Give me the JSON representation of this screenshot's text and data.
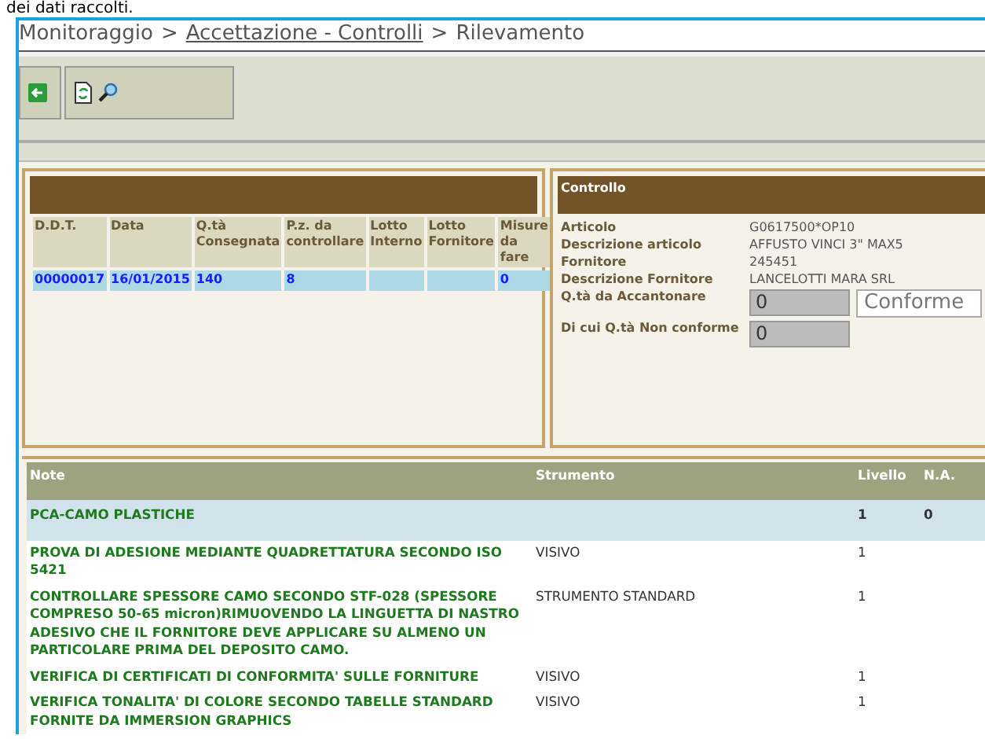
{
  "top_text": "dei dati raccolti.",
  "breadcrumb": [
    {
      "label": "Monitoraggio",
      "link": false
    },
    {
      "label": "Accettazione - Controlli",
      "link": true
    },
    {
      "label": "Rilevamento",
      "link": false
    }
  ],
  "breadcrumb_separator": ">",
  "ddt_table": {
    "columns": [
      "D.D.T.",
      "Data",
      "Q.tà Consegnata",
      "P.z. da controllare",
      "Lotto Interno",
      "Lotto Fornitore",
      "Misure da fare"
    ],
    "rows": [
      {
        "selected": true,
        "cells": [
          "00000017",
          "16/01/2015",
          "140",
          "8",
          "",
          "",
          "0"
        ]
      }
    ]
  },
  "controllo": {
    "title": "Controllo",
    "fields": [
      {
        "label": "Articolo",
        "value": "G0617500*OP10"
      },
      {
        "label": "Descrizione articolo",
        "value": "AFFUSTO VINCI 3\" MAX5"
      },
      {
        "label": "Fornitore",
        "value": "245451"
      },
      {
        "label": "Descrizione Fornitore",
        "value": "LANCELOTTI MARA SRL"
      }
    ],
    "qty_accantonare": {
      "label": "Q.tà da Accantonare",
      "value": "0",
      "status": "Conforme"
    },
    "qty_non_conforme": {
      "label": "Di cui Q.tà Non conforme",
      "value": "0"
    }
  },
  "checks_table": {
    "columns": [
      "Note",
      "Strumento",
      "Livello",
      "N.A."
    ],
    "rows": [
      {
        "kind": "group",
        "note": "PCA-CAMO PLASTICHE",
        "strumento": "",
        "livello": "1",
        "na": "0"
      },
      {
        "kind": "item",
        "note": " PROVA DI ADESIONE MEDIANTE QUADRETTATURA SECONDO ISO 5421",
        "strumento": "VISIVO",
        "livello": "1",
        "na": ""
      },
      {
        "kind": "item",
        "note": " CONTROLLARE SPESSORE CAMO SECONDO STF-028 (SPESSORE COMPRESO 50-65 micron)RIMUOVENDO LA LINGUETTA DI NASTRO ADESIVO CHE IL FORNITORE DEVE APPLICARE SU ALMENO UN PARTICOLARE PRIMA DEL DEPOSITO CAMO.",
        "strumento": "STRUMENTO STANDARD",
        "livello": "1",
        "na": ""
      },
      {
        "kind": "item",
        "note": " VERIFICA DI CERTIFICATI DI CONFORMITA' SULLE FORNITURE",
        "strumento": "VISIVO",
        "livello": "1",
        "na": ""
      },
      {
        "kind": "item",
        "note": " VERIFICA TONALITA' DI COLORE SECONDO TABELLE STANDARD FORNITE DA IMMERSION GRAPHICS",
        "strumento": "VISIVO",
        "livello": "1",
        "na": ""
      }
    ]
  }
}
